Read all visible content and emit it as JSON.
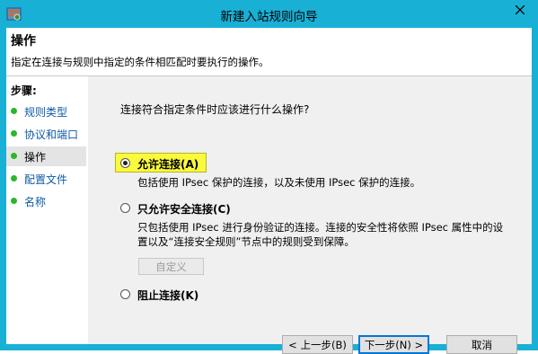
{
  "window": {
    "title": "新建入站规则向导"
  },
  "header": {
    "title": "操作",
    "description": "指定在连接与规则中指定的条件相匹配时要执行的操作。"
  },
  "steps": {
    "title": "步骤:",
    "items": [
      "规则类型",
      "协议和端口",
      "操作",
      "配置文件",
      "名称"
    ],
    "current_index": 2
  },
  "main": {
    "question": "连接符合指定条件时应该进行什么操作?",
    "options": [
      {
        "label": "允许连接(A)",
        "desc": "包括使用 IPsec 保护的连接，以及未使用 IPsec 保护的连接。",
        "selected": true
      },
      {
        "label": "只允许安全连接(C)",
        "desc_line1": "只包括使用 IPsec 进行身份验证的连接。连接的安全性将依照 IPsec 属性中的设",
        "desc_line2": "置以及“连接安全规则”节点中的规则受到保障。",
        "selected": false
      },
      {
        "label": "阻止连接(K)",
        "selected": false
      }
    ],
    "customize_label": "自定义"
  },
  "buttons": {
    "back": "< 上一步(B)",
    "next": "下一步(N) >",
    "cancel": "取消"
  },
  "colors": {
    "titlebar": "#19b0d6",
    "highlight": "#fafa3c",
    "step_dot": "#2db52d",
    "link": "#0f5aa6"
  }
}
